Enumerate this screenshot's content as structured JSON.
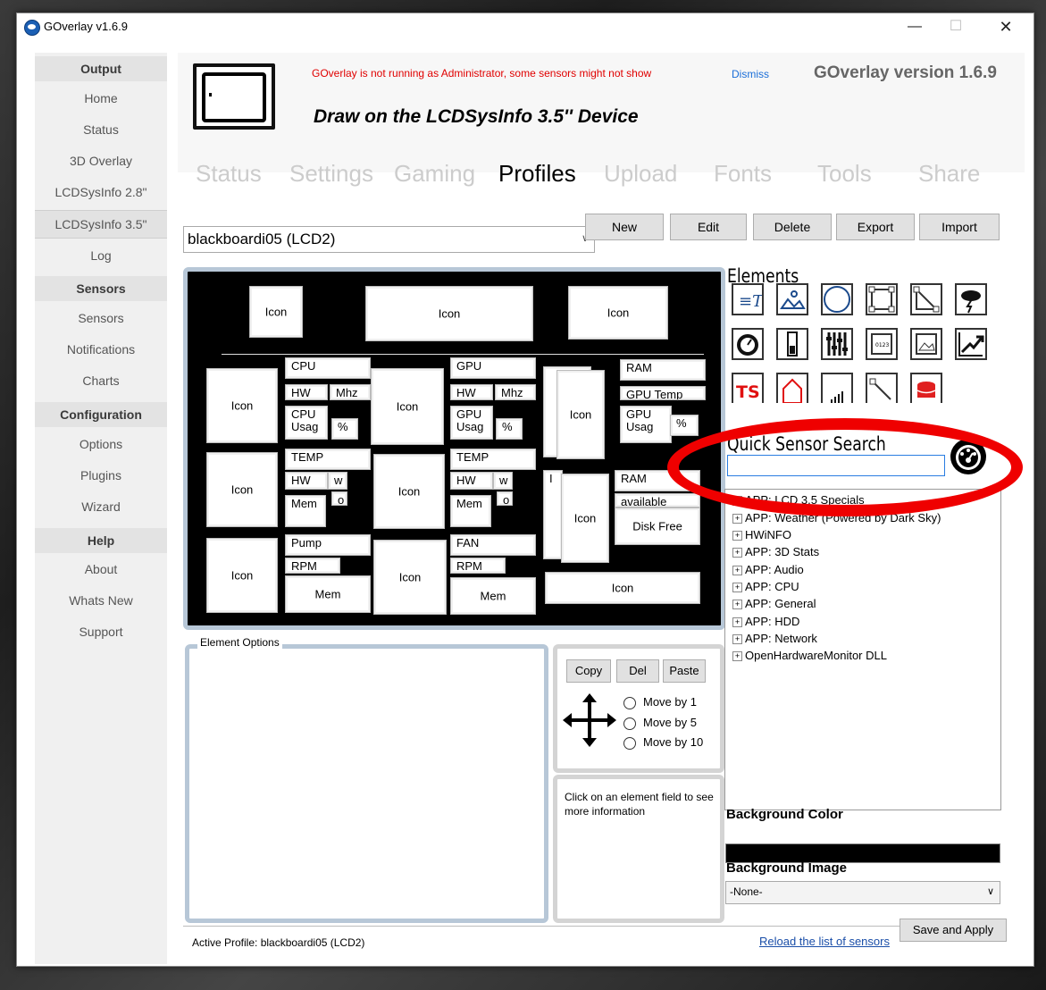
{
  "window": {
    "title": "GOverlay v1.6.9",
    "minimize": "—",
    "maximize": "☐",
    "close": "✕"
  },
  "sidebar": {
    "sections": [
      {
        "header": "Output",
        "items": [
          "Home",
          "Status",
          "3D Overlay",
          "LCDSysInfo 2.8\"",
          "LCDSysInfo 3.5\"",
          "Log"
        ]
      },
      {
        "header": "Sensors",
        "items": [
          "Sensors",
          "Notifications",
          "Charts"
        ]
      },
      {
        "header": "Configuration",
        "items": [
          "Options",
          "Plugins",
          "Wizard"
        ]
      },
      {
        "header": "Help",
        "items": [
          "About",
          "Whats New",
          "Support"
        ]
      }
    ],
    "selected": "LCDSysInfo 3.5\""
  },
  "header": {
    "warning": "GOverlay is not running as Administrator, some sensors might not show",
    "dismiss": "Dismiss",
    "version": "GOverlay version 1.6.9",
    "subtitle": "Draw on the LCDSysInfo 3.5'' Device"
  },
  "tabs": [
    "Status",
    "Settings",
    "Gaming",
    "Profiles",
    "Upload",
    "Fonts",
    "Tools",
    "Share"
  ],
  "active_tab": "Profiles",
  "profile": {
    "selected": "blackboardi05  (LCD2)",
    "buttons": [
      "New",
      "Edit",
      "Delete",
      "Export",
      "Import"
    ]
  },
  "canvas": {
    "icon": "Icon",
    "labels": {
      "cpu": "CPU",
      "gpu": "GPU",
      "ram": "RAM",
      "hw": "HW",
      "mhz": "Mhz",
      "cpu_usag": "CPU\nUsag",
      "gpu_usag": "GPU\nUsag",
      "pct": "%",
      "temp": "TEMP",
      "w": "w",
      "o": "o",
      "mem": "Mem",
      "pump": "Pump",
      "rpm": "RPM",
      "fan": "FAN",
      "gpu_temp": "GPU Temp",
      "available": "available",
      "diskfree": "Disk Free",
      "l": "I"
    }
  },
  "elements": {
    "title": "Elements",
    "icons": [
      "text-icon",
      "image-icon",
      "circle-icon",
      "rectangle-icon",
      "line-icon",
      "weather-icon",
      "gauge-icon",
      "bar-icon",
      "equalizer-icon",
      "counter-icon",
      "picture-icon",
      "chart-icon",
      "ts-icon",
      "shape-icon",
      "signal-icon",
      "arrow-icon",
      "database-icon"
    ],
    "ts_label": "TS",
    "counter_label": "0123"
  },
  "quick_search": {
    "title": "Quick Sensor Search",
    "value": ""
  },
  "tree": {
    "items": [
      "APP: LCD 3.5 Specials",
      "APP: Weather (Powered by Dark Sky)",
      "HWiNFO",
      "APP: 3D Stats",
      "APP: Audio",
      "APP: CPU",
      "APP: General",
      "APP: HDD",
      "APP: Network",
      "OpenHardwareMonitor DLL"
    ]
  },
  "background": {
    "color_label": "Background Color",
    "color": "#000000",
    "image_label": "Background Image",
    "image_value": "-None-"
  },
  "element_options": {
    "title": "Element Options"
  },
  "move": {
    "copy": "Copy",
    "del": "Del",
    "paste": "Paste",
    "options": [
      "Move by 1",
      "Move by 5",
      "Move by 10"
    ]
  },
  "info": {
    "text": "Click on an element field to see more information"
  },
  "footer": {
    "active_profile": "Active Profile: blackboardi05  (LCD2)",
    "reload": "Reload the list of sensors",
    "save": "Save and Apply"
  },
  "colors": {
    "highlight": "#ef0000",
    "link": "#1a6ed8",
    "warning": "#e00000",
    "frame": "#b7c7d7"
  }
}
